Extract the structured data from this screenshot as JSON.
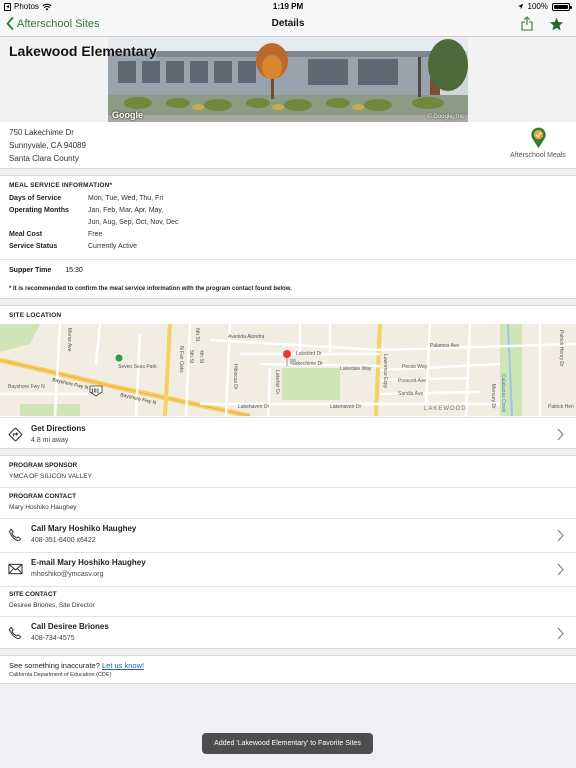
{
  "status_bar": {
    "back_app": "Photos",
    "time": "1:19 PM",
    "battery": "100%",
    "battery_level": 1.0
  },
  "nav": {
    "back_label": "Afterschool Sites",
    "title": "Details"
  },
  "site": {
    "name": "Lakewood Elementary",
    "street_view_logo": "Google",
    "street_view_copyright": "© Google, Inc",
    "address_line1": "750 Lakechime Dr",
    "address_line2": "Sunnyvale, CA 94089",
    "county": "Santa Clara County",
    "program_logo_label": "Afterschool Meals"
  },
  "meal_service": {
    "heading": "MEAL SERVICE INFORMATION*",
    "days_label": "Days of Service",
    "days_value": "Mon, Tue, Wed, Thu, Fri",
    "months_label": "Operating Months",
    "months_line1": "Jan, Feb, Mar, Apr, May,",
    "months_line2": "Jun, Aug, Sep, Oct, Nov, Dec",
    "cost_label": "Meal Cost",
    "cost_value": "Free",
    "status_label": "Service Status",
    "status_value": "Currently Active",
    "supper_label": "Supper Time",
    "supper_value": "15:30",
    "note": "* It is recommended to confirm the meal service information with the program contact found below."
  },
  "location": {
    "heading": "SITE LOCATION",
    "map_labels": {
      "aveniva": "Avenida Alondra",
      "lakebird": "Lakebird Dr",
      "lakechime": "Lakechime Dr",
      "lakedale": "Lakedale Way",
      "lakehaven": "Lakehaven Dr",
      "bayshore1": "Bayshore Fwy N",
      "bayshore2": "Bayshore Fwy N",
      "shield": "101",
      "park": "Seven Seas Park",
      "area": "LAKEWOOD",
      "palamos": "Palamos Ave",
      "pecos": "Pecos Way",
      "prescott": "Prescott Ave",
      "sandia": "Sandia Ave",
      "lawrence": "Lawrence Expy",
      "calabazas": "Calabazas Creek",
      "patrick": "Patrick Henry Dr",
      "patrick2": "Patrick Hen",
      "fairoaks": "N Fair Oaks",
      "hibiscus": "Hibiscus Dr",
      "morse": "Morse Ave",
      "st4": "4th St",
      "st5": "5th St",
      "st6": "6th St",
      "lakeside": "Lakefair Dr",
      "madrid": "Mercury Dr"
    },
    "directions_title": "Get Directions",
    "directions_distance": "4.8 mi away"
  },
  "contacts": {
    "sponsor_label": "PROGRAM SPONSOR",
    "sponsor_value": "YMCA OF SILICON VALLEY",
    "program_contact_label": "PROGRAM CONTACT",
    "program_contact_value": "Mary Hoshiko Haughey",
    "call_title": "Call Mary Hoshiko Haughey",
    "call_number": "408-351-6400 x6422",
    "email_title": "E-mail Mary Hoshiko Haughey",
    "email_address": "mhoshiko@ymcasv.org",
    "site_contact_label": "SITE CONTACT",
    "site_contact_value": "Desiree Briones, Site Director",
    "call2_title": "Call Desiree Briones",
    "call2_number": "408-734-4575"
  },
  "footer": {
    "question": "See something inaccurate?",
    "link": "Let us know!",
    "source": "California Department of Education (CDE)"
  },
  "toast": "Added 'Lakewood Elementary' to Favorite Sites",
  "colors": {
    "accent": "#2e7d32",
    "link": "#1a5fd1",
    "toast_bg": "#4d4d4d"
  }
}
